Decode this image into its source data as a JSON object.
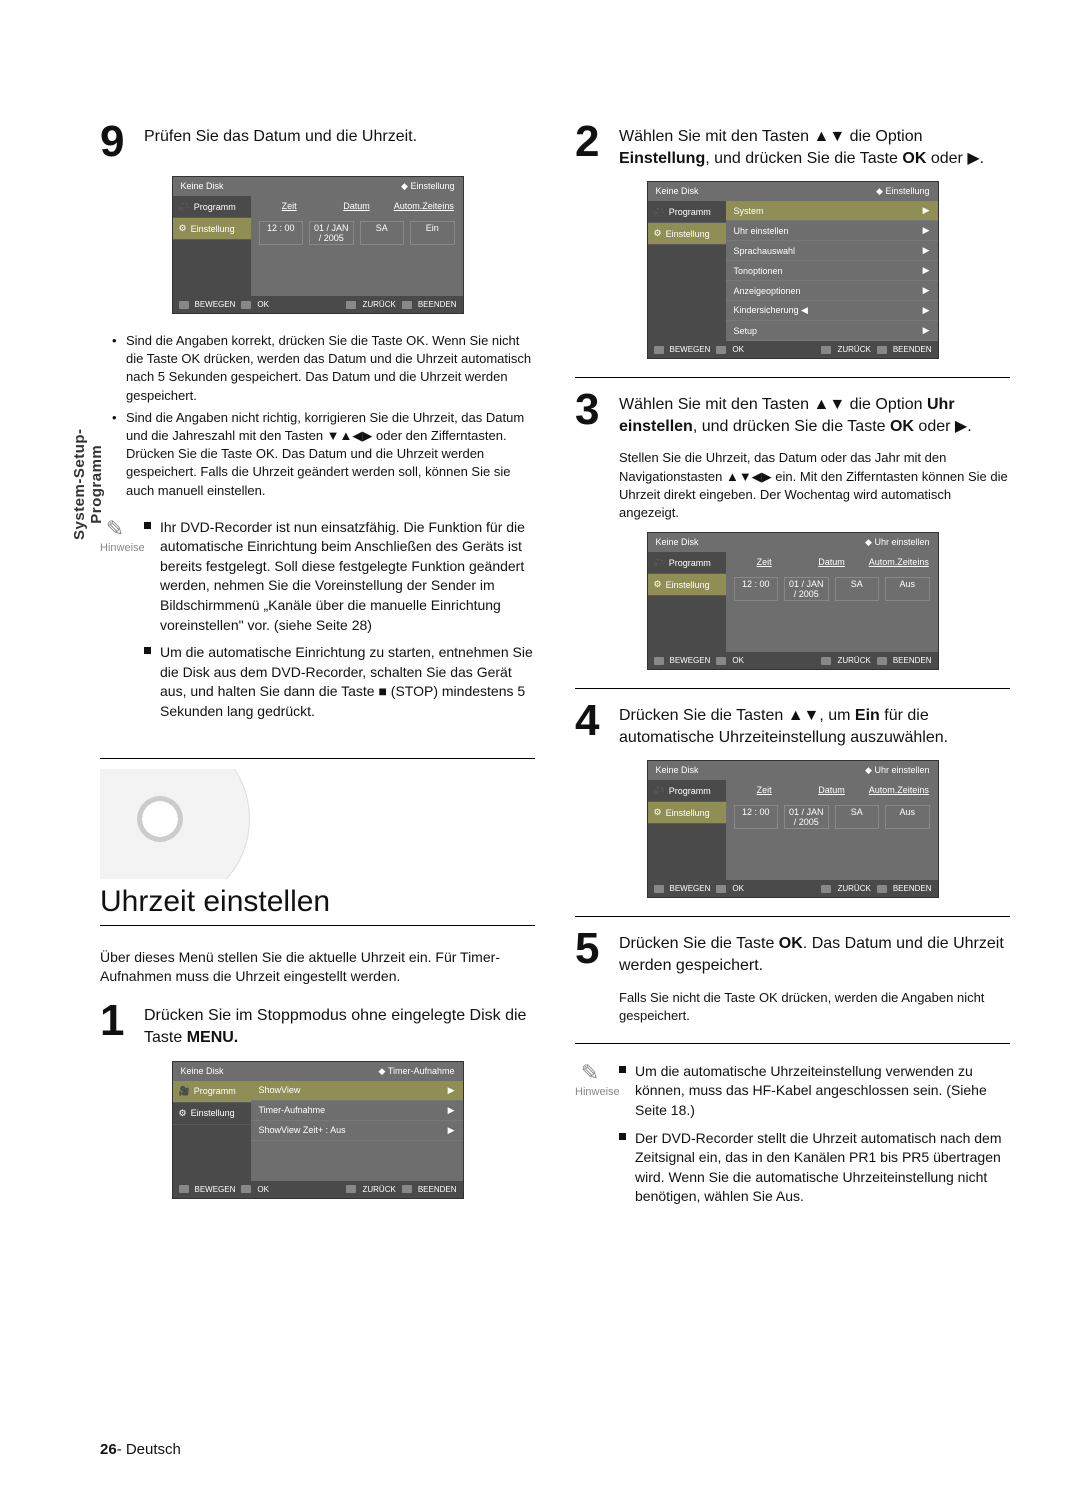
{
  "side_label": {
    "line1": "System-Setup-",
    "line2": "Programm"
  },
  "page_footer": {
    "num": "26",
    "lang": "- Deutsch"
  },
  "left": {
    "step9": {
      "num": "9",
      "text": "Prüfen Sie das Datum und die Uhrzeit."
    },
    "bullets9": [
      "Sind die Angaben korrekt, drücken Sie die Taste OK. Wenn Sie nicht die Taste OK drücken, werden das Datum und die Uhrzeit automatisch nach 5 Sekunden gespeichert. Das Datum und die Uhrzeit werden gespeichert.",
      "Sind die Angaben nicht richtig, korrigieren Sie die Uhrzeit, das Datum und die Jahreszahl mit den Tasten ▼▲◀▶ oder den Zifferntasten. Drücken Sie die Taste OK. Das Datum und die Uhrzeit werden gespeichert. Falls die Uhrzeit geändert werden soll, können Sie sie auch manuell einstellen."
    ],
    "hint_label": "Hinweise",
    "hints9": [
      "Ihr DVD-Recorder ist nun einsatzfähig. Die Funktion für die automatische Einrichtung beim Anschließen des Geräts ist bereits festgelegt. Soll diese festgelegte Funktion geändert werden, nehmen Sie die Voreinstellung der Sender im Bildschirmmenü „Kanäle über die manuelle Einrichtung voreinstellen\" vor. (siehe Seite 28)",
      "Um die automatische Einrichtung zu starten, entnehmen Sie die Disk aus dem DVD-Recorder, schalten Sie das Gerät aus, und halten Sie dann die Taste ■ (STOP) mindestens 5 Sekunden lang gedrückt."
    ],
    "section_title": "Uhrzeit einstellen",
    "section_intro": "Über dieses Menü stellen Sie die aktuelle Uhrzeit ein. Für Timer-Aufnahmen muss die Uhrzeit eingestellt werden.",
    "step1": {
      "num": "1",
      "text_a": "Drücken Sie im Stoppmodus ohne eingelegte Disk die Taste ",
      "text_b": "MENU."
    }
  },
  "right": {
    "step2": {
      "num": "2",
      "a": "Wählen Sie mit den Tasten ▲▼ die Option ",
      "b": "Einstellung",
      "c": ", und drücken Sie die Taste ",
      "d": "OK",
      "e": " oder ▶."
    },
    "step3": {
      "num": "3",
      "a": "Wählen Sie mit den Tasten ▲▼ die Option ",
      "b": "Uhr einstellen",
      "c": ", und drücken Sie die Taste ",
      "d": "OK",
      "e": " oder ▶."
    },
    "step3_sub": "Stellen Sie die Uhrzeit, das Datum oder das Jahr mit den Navigationstasten ▲▼◀▶ ein. Mit den Zifferntasten können Sie die Uhrzeit direkt eingeben. Der Wochentag wird automatisch angezeigt.",
    "step4": {
      "num": "4",
      "a": "Drücken Sie die Tasten ▲▼, um ",
      "b": "Ein",
      "c": " für die automatische Uhrzeiteinstellung auszuwählen."
    },
    "step5": {
      "num": "5",
      "a": "Drücken Sie die Taste ",
      "b": "OK",
      "c": ". Das Datum und die Uhrzeit werden gespeichert."
    },
    "step5_sub": "Falls Sie nicht die Taste OK drücken, werden die Angaben nicht gespeichert.",
    "hints5": [
      "Um die automatische Uhrzeiteinstellung verwenden zu können, muss das HF-Kabel angeschlossen sein. (Siehe Seite 18.)",
      "Der DVD-Recorder stellt die Uhrzeit automatisch nach dem Zeitsignal ein, das in den Kanälen PR1 bis PR5 übertragen wird. Wenn Sie die automatische Uhrzeiteinstellung nicht benötigen, wählen Sie Aus."
    ]
  },
  "osd_common": {
    "no_disk": "Keine Disk",
    "side_programm": "Programm",
    "side_einstellung": "Einstellung",
    "footer_move": "BEWEGEN",
    "footer_ok": "OK",
    "footer_back": "ZURÜCK",
    "footer_exit": "BEENDEN",
    "hdr_zeit": "Zeit",
    "hdr_datum": "Datum",
    "hdr_auto": "Autom.Zeiteins",
    "time": "12 : 00",
    "date": "01 / JAN / 2005",
    "day": "SA"
  },
  "osd": {
    "box1": {
      "title_right": "Einstellung",
      "auto_val": "Ein"
    },
    "box_timer": {
      "title_right": "Timer-Aufnahme",
      "items": [
        "ShowView",
        "Timer-Aufnahme",
        "ShowView Zeit+ : Aus"
      ]
    },
    "box_settings": {
      "title_right": "Einstellung",
      "top": "System",
      "items": [
        "Uhr einstellen",
        "Sprachauswahl",
        "Tonoptionen",
        "Anzeigeoptionen",
        "Kindersicherung ◀",
        "Setup"
      ]
    },
    "box_clock_aus": {
      "title_right": "Uhr einstellen",
      "auto_val": "Aus"
    },
    "box_clock_aus2": {
      "title_right": "Uhr einstellen",
      "auto_val": "Aus"
    }
  }
}
